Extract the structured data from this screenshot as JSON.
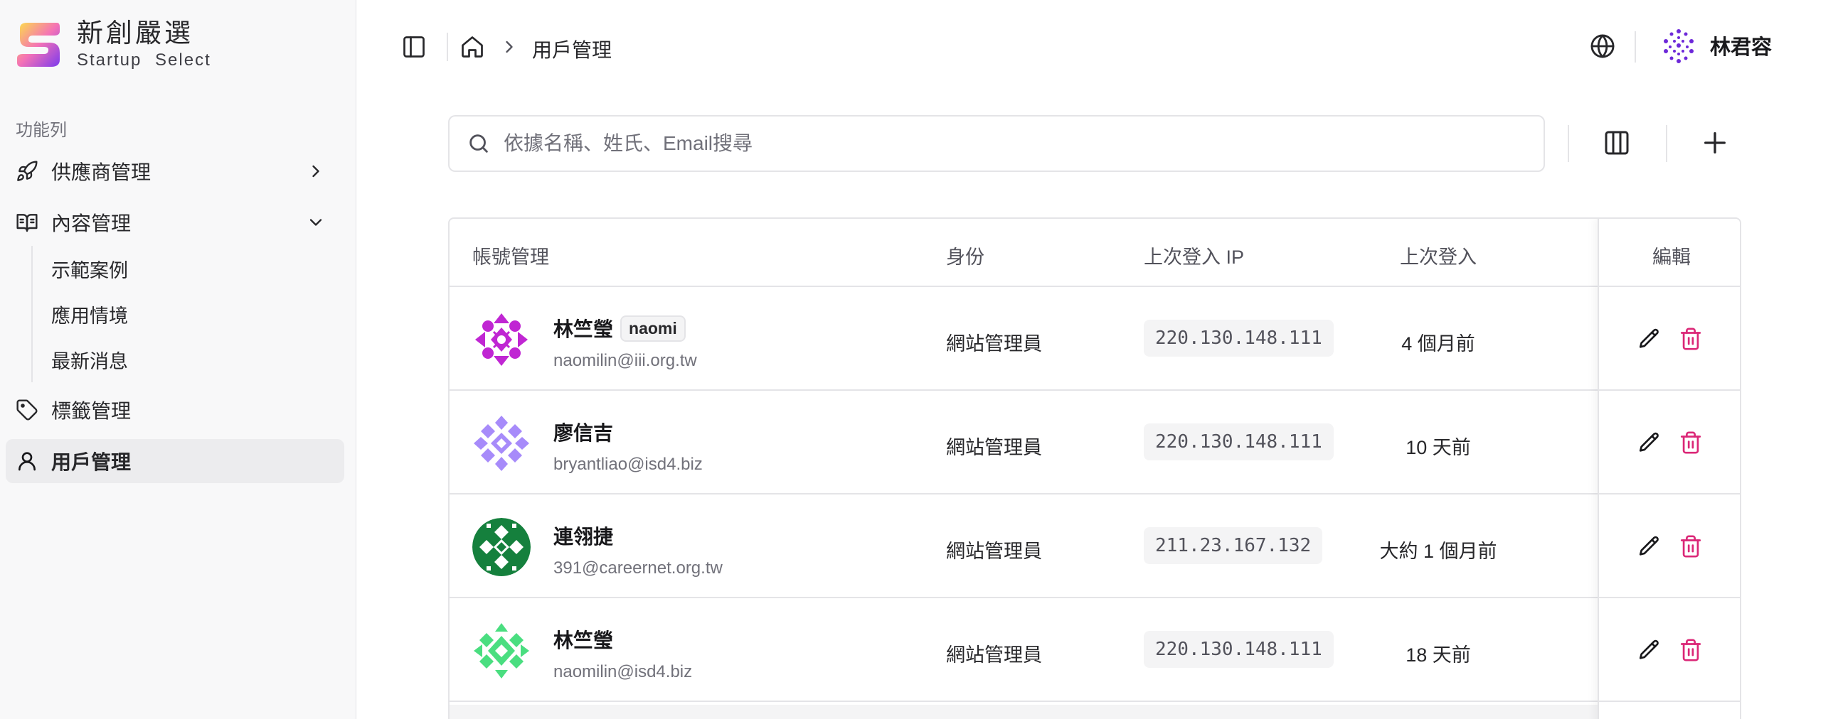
{
  "brand": {
    "title": "新創嚴選",
    "subtitle": "Startup Select"
  },
  "sidebar": {
    "section_label": "功能列",
    "items": [
      {
        "label": "供應商管理",
        "icon": "rocket-icon"
      },
      {
        "label": "內容管理",
        "icon": "book-open-icon"
      },
      {
        "label": "標籤管理",
        "icon": "tag-icon"
      },
      {
        "label": "用戶管理",
        "icon": "user-icon"
      }
    ],
    "sub_items": [
      "示範案例",
      "應用情境",
      "最新消息"
    ]
  },
  "header": {
    "breadcrumb_current": "用戶管理",
    "user_name": "林君容"
  },
  "search": {
    "placeholder": "依據名稱、姓氏、Email搜尋"
  },
  "table": {
    "columns": [
      "帳號管理",
      "身份",
      "上次登入 IP",
      "上次登入",
      "編輯"
    ],
    "rows": [
      {
        "name": "林竺瑩",
        "nickname": "naomi",
        "email": "naomilin@iii.org.tw",
        "role": "網站管理員",
        "ip": "220.130.148.111",
        "last_login": "4 個月前",
        "avatar_color": "#c026d3"
      },
      {
        "name": "廖信吉",
        "nickname": "",
        "email": "bryantliao@isd4.biz",
        "role": "網站管理員",
        "ip": "220.130.148.111",
        "last_login": "10 天前",
        "avatar_color": "#a78bfa"
      },
      {
        "name": "連翎捷",
        "nickname": "",
        "email": "391@careernet.org.tw",
        "role": "網站管理員",
        "ip": "211.23.167.132",
        "last_login": "大約 1 個月前",
        "avatar_color": "#15803d"
      },
      {
        "name": "林竺瑩",
        "nickname": "",
        "email": "naomilin@isd4.biz",
        "role": "網站管理員",
        "ip": "220.130.148.111",
        "last_login": "18 天前",
        "avatar_color": "#4ade80"
      }
    ]
  },
  "colors": {
    "delete": "#db2777",
    "user_avatar": "#6d28d9"
  }
}
